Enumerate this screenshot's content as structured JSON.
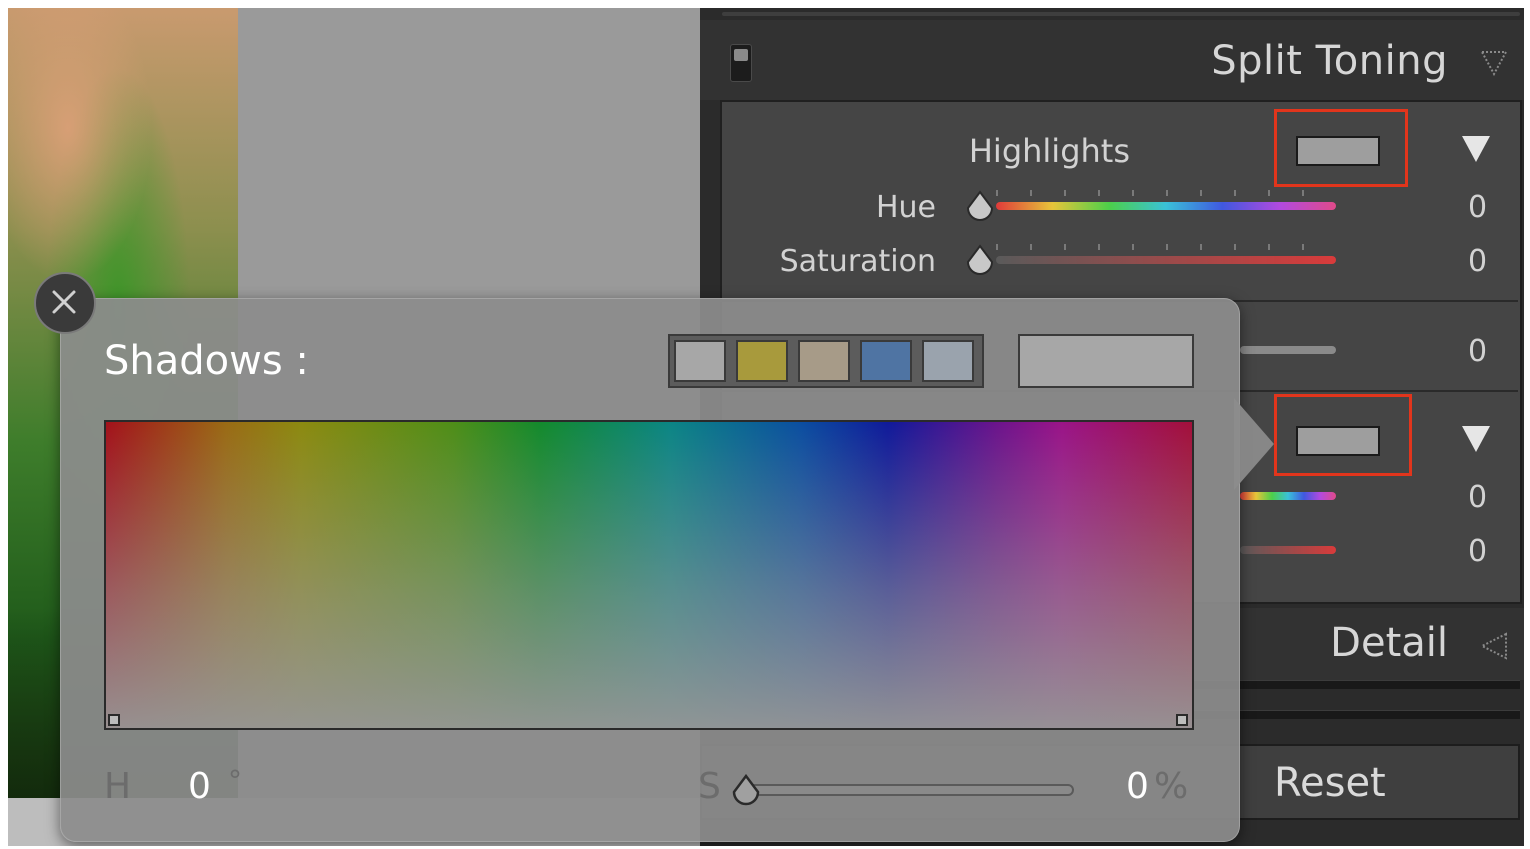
{
  "split_toning": {
    "title": "Split Toning",
    "highlights": {
      "label": "Highlights",
      "hue_label": "Hue",
      "hue_value": "0",
      "saturation_label": "Saturation",
      "saturation_value": "0"
    },
    "balance_value": "0",
    "shadows": {
      "hue_value": "0",
      "saturation_value": "0"
    }
  },
  "detail": {
    "title": "Detail"
  },
  "reset_label": "Reset",
  "popup": {
    "title": "Shadows :",
    "h_label": "H",
    "h_value": "0",
    "h_unit": "°",
    "s_label": "S",
    "s_value": "0",
    "s_unit": "%",
    "presets": [
      "#a7a7a7",
      "#a89a3c",
      "#a79b88",
      "#4f74a3",
      "#9aa3ad"
    ],
    "current_color": "#a7a7a7"
  },
  "colors": {
    "highlight_box": "#e2351c",
    "panel_bg": "#2b2b2b"
  }
}
